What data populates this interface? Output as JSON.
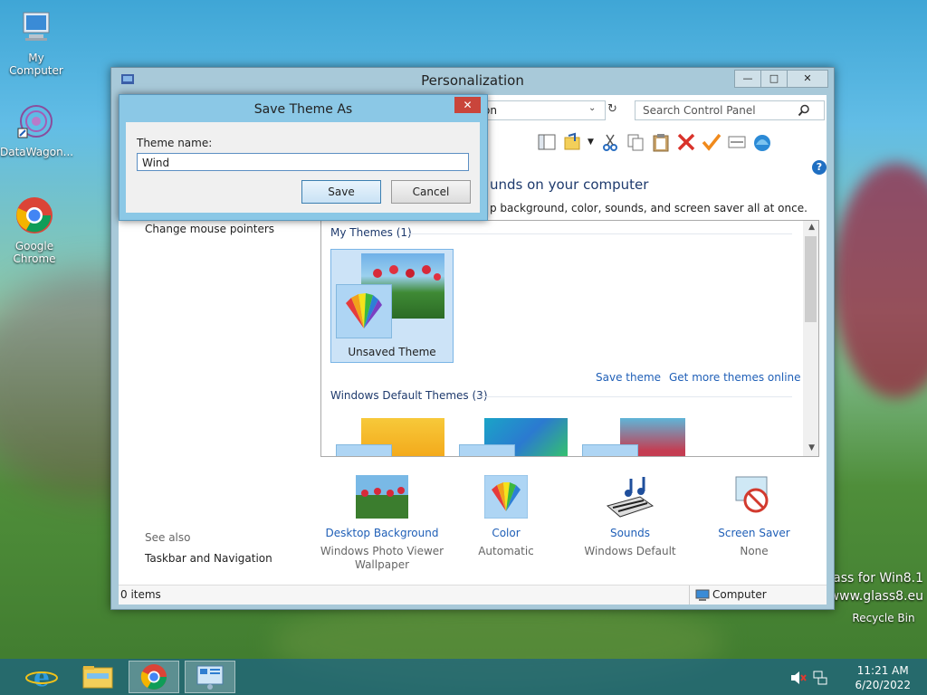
{
  "desktop": {
    "icons": [
      {
        "label": "My Computer"
      },
      {
        "label": "DataWagon..."
      },
      {
        "label": "Google Chrome"
      }
    ],
    "watermark_line1": "lass for Win8.1",
    "watermark_line2": "www.glass8.eu",
    "recycle_label": "Recycle Bin"
  },
  "window": {
    "title": "Personalization",
    "min_glyph": "—",
    "max_glyph": "□",
    "close_glyph": "✕",
    "address_text": "on",
    "search_placeholder": "Search Control Panel",
    "help_glyph": "?",
    "headline": "unds on your computer",
    "subline": "p background, color, sounds, and screen saver all at once.",
    "left_link": "Change mouse pointers",
    "see_also": "See also",
    "taskbar_link": "Taskbar and Navigation",
    "my_themes_header": "My Themes (1)",
    "unsaved_theme_label": "Unsaved Theme",
    "save_theme_link": "Save theme",
    "get_more_link": "Get more themes online",
    "default_themes_header": "Windows Default Themes (3)",
    "bottom_items": [
      {
        "title": "Desktop Background",
        "subtitle": "Windows Photo Viewer Wallpaper"
      },
      {
        "title": "Color",
        "subtitle": "Automatic"
      },
      {
        "title": "Sounds",
        "subtitle": "Windows Default"
      },
      {
        "title": "Screen Saver",
        "subtitle": "None"
      }
    ],
    "status_items": "0 items",
    "status_location": "Computer"
  },
  "dialog": {
    "title": "Save Theme As",
    "close_glyph": "✕",
    "field_label": "Theme name:",
    "field_value": "Wind",
    "save_label": "Save",
    "cancel_label": "Cancel"
  },
  "taskbar": {
    "time": "11:21 AM",
    "date": "6/20/2022"
  },
  "colors": {
    "accent": "#1f5fb7",
    "dialog_frame": "#8bc8e6",
    "window_frame": "#a8c9d9",
    "close_red": "#c9453b"
  }
}
